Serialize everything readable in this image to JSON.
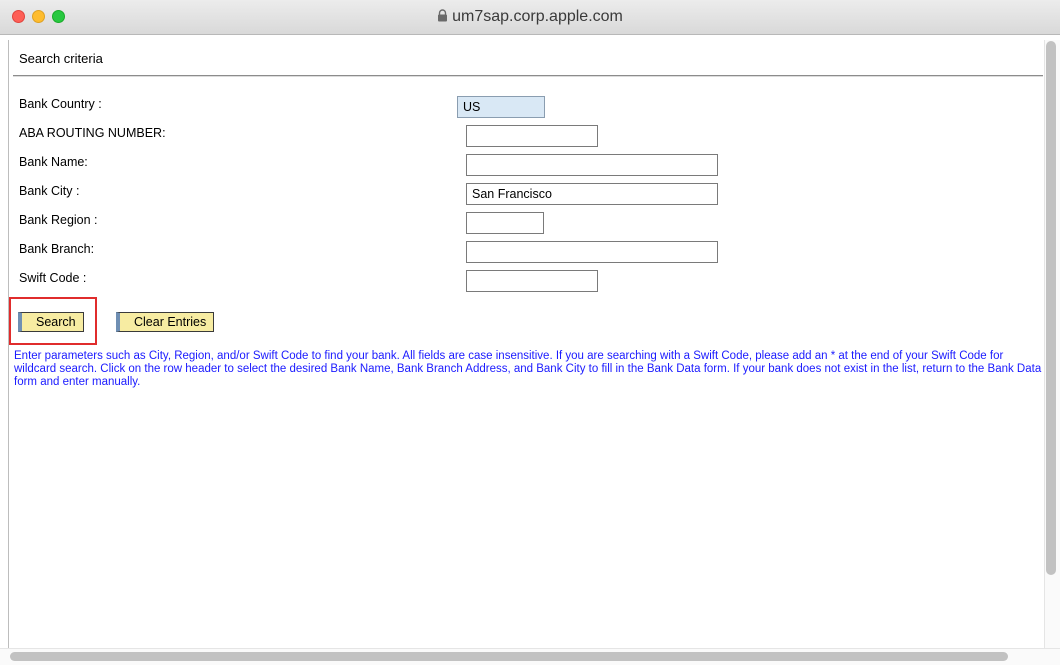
{
  "window": {
    "title": "um7sap.corp.apple.com",
    "lock_icon": "lock-icon"
  },
  "form": {
    "section_title": "Search criteria",
    "fields": {
      "bank_country": {
        "label": "Bank Country :",
        "value": "US"
      },
      "aba_routing": {
        "label": "ABA ROUTING NUMBER:",
        "value": ""
      },
      "bank_name": {
        "label": "Bank Name:",
        "value": ""
      },
      "bank_city": {
        "label": "Bank City :",
        "value": "San Francisco"
      },
      "bank_region": {
        "label": "Bank Region :",
        "value": ""
      },
      "bank_branch": {
        "label": "Bank Branch:",
        "value": ""
      },
      "swift_code": {
        "label": "Swift Code :",
        "value": ""
      }
    },
    "buttons": {
      "search": "Search",
      "clear": "Clear Entries"
    },
    "help_text": "Enter parameters such as City, Region, and/or Swift Code to find your bank. All fields are case insensitive. If you are searching with a Swift Code, please add an * at the end of your Swift Code for wildcard search. Click on the row header to select the desired Bank Name, Bank Branch Address, and Bank City to fill in the Bank Data form. If your bank does not exist in the list, return to the Bank Data form and enter manually."
  },
  "colors": {
    "button_bg": "#f7eca2",
    "help_text": "#1a1aff",
    "highlight": "#e02c2c",
    "readonly_field_bg": "#d9e8f5"
  }
}
